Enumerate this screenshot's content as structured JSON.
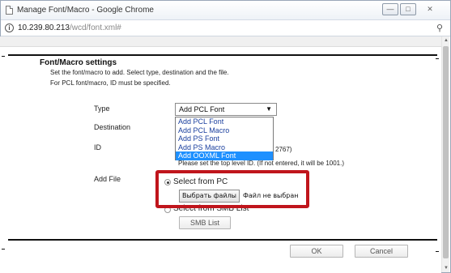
{
  "window": {
    "title": "Manage Font/Macro - Google Chrome",
    "controls": {
      "minimize": "—",
      "maximize": "□",
      "close": "✕"
    }
  },
  "address": {
    "info_icon": "i",
    "host": "10.239.80.213",
    "path": "/wcd/font.xml#",
    "extension_icon": "puzzle-icon"
  },
  "settings": {
    "title": "Font/Macro settings",
    "desc1": "Set the font/macro to add. Select type, destination and the file.",
    "desc2": "For PCL font/macro, ID must be specified.",
    "type_label": "Type",
    "destination_label": "Destination",
    "id_label": "ID",
    "add_file_label": "Add File",
    "type_selected": "Add PCL Font",
    "type_options": [
      "Add PCL Font",
      "Add PCL Macro",
      "Add PS Font",
      "Add PS Macro",
      "Add OOXML Font"
    ],
    "highlighted_option": "Add OOXML Font",
    "id_range_tail": "2767)",
    "id_hint": "Please set the top level ID. (If not entered, it will be 1001.)",
    "radio_pc_label": "Select from PC",
    "radio_smb_label": "Select from SMB List",
    "file_button": "Выбрать файлы",
    "file_status": "Файл не выбран",
    "smb_button": "SMB List"
  },
  "footer": {
    "ok": "OK",
    "cancel": "Cancel"
  },
  "colors": {
    "highlight_box": "#c0151c",
    "option_selected_bg": "#1e90ff",
    "option_text": "#1a3f9e"
  }
}
